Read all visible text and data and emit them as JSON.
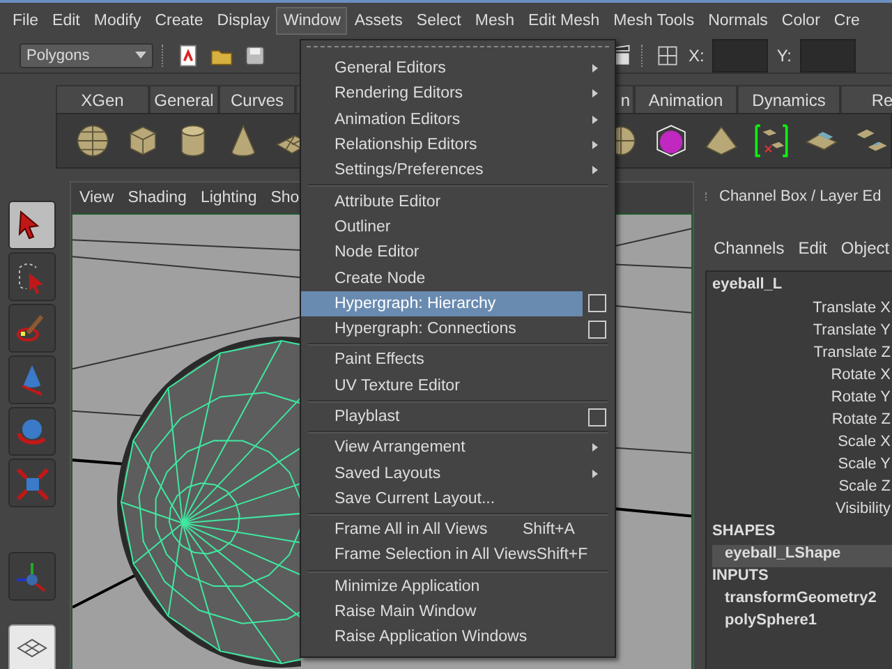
{
  "menu_bar": [
    {
      "label": "File",
      "selected": false
    },
    {
      "label": "Edit",
      "selected": false
    },
    {
      "label": "Modify",
      "selected": false
    },
    {
      "label": "Create",
      "selected": false
    },
    {
      "label": "Display",
      "selected": false
    },
    {
      "label": "Window",
      "selected": true
    },
    {
      "label": "Assets",
      "selected": false
    },
    {
      "label": "Select",
      "selected": false
    },
    {
      "label": "Mesh",
      "selected": false
    },
    {
      "label": "Edit Mesh",
      "selected": false
    },
    {
      "label": "Mesh Tools",
      "selected": false
    },
    {
      "label": "Normals",
      "selected": false
    },
    {
      "label": "Color",
      "selected": false
    },
    {
      "label": "Cre",
      "selected": false
    }
  ],
  "toolbar": {
    "mode_dropdown": "Polygons",
    "x_label": "X:",
    "y_label": "Y:"
  },
  "shelf": {
    "tabs": [
      {
        "label": "XGen",
        "selected": false
      },
      {
        "label": "General",
        "selected": false
      },
      {
        "label": "Curves",
        "selected": false
      },
      {
        "label": "n",
        "selected": false
      },
      {
        "label": "Animation",
        "selected": false
      },
      {
        "label": "Dynamics",
        "selected": false
      },
      {
        "label": "Re",
        "selected": false
      }
    ]
  },
  "toolbox": {
    "tools": [
      {
        "kind": "select",
        "selected": true
      },
      {
        "kind": "lasso",
        "selected": false
      },
      {
        "kind": "paint",
        "selected": false
      },
      {
        "kind": "move",
        "selected": false
      },
      {
        "kind": "rotate",
        "selected": false
      },
      {
        "kind": "scale",
        "selected": false
      },
      {
        "kind": "manipulator",
        "selected": false
      }
    ]
  },
  "viewport": {
    "menus": [
      "View",
      "Shading",
      "Lighting",
      "Sho"
    ]
  },
  "channel_box": {
    "title": "Channel Box / Layer Ed",
    "menus": [
      "Channels",
      "Edit",
      "Object"
    ],
    "object": "eyeball_L",
    "channels": [
      "Translate X",
      "Translate Y",
      "Translate Z",
      "Rotate X",
      "Rotate Y",
      "Rotate Z",
      "Scale X",
      "Scale Y",
      "Scale Z",
      "Visibility"
    ],
    "shapes_heading": "SHAPES",
    "shapes": [
      {
        "label": "eyeball_LShape",
        "selected": true
      }
    ],
    "inputs_heading": "INPUTS",
    "inputs": [
      "transformGeometry2",
      "polySphere1"
    ]
  },
  "window_menu": {
    "sections": [
      [
        {
          "label": "General Editors",
          "kind": "submenu",
          "selected": false
        },
        {
          "label": "Rendering Editors",
          "kind": "submenu",
          "selected": false
        },
        {
          "label": "Animation Editors",
          "kind": "submenu",
          "selected": false
        },
        {
          "label": "Relationship Editors",
          "kind": "submenu",
          "selected": false
        },
        {
          "label": "Settings/Preferences",
          "kind": "submenu",
          "selected": false
        }
      ],
      [
        {
          "label": "Attribute Editor",
          "kind": "plain",
          "selected": false
        },
        {
          "label": "Outliner",
          "kind": "plain",
          "selected": false
        },
        {
          "label": "Node Editor",
          "kind": "plain",
          "selected": false
        },
        {
          "label": "Create Node",
          "kind": "plain",
          "selected": false
        },
        {
          "label": "Hypergraph: Hierarchy",
          "kind": "option",
          "selected": true
        },
        {
          "label": "Hypergraph: Connections",
          "kind": "option",
          "selected": false
        }
      ],
      [
        {
          "label": "Paint Effects",
          "kind": "plain",
          "selected": false
        },
        {
          "label": "UV Texture Editor",
          "kind": "plain",
          "selected": false
        }
      ],
      [
        {
          "label": "Playblast",
          "kind": "option",
          "selected": false
        }
      ],
      [
        {
          "label": "View Arrangement",
          "kind": "submenu",
          "selected": false
        },
        {
          "label": "Saved Layouts",
          "kind": "submenu",
          "selected": false
        },
        {
          "label": "Save Current Layout...",
          "kind": "plain",
          "selected": false
        }
      ],
      [
        {
          "label": "Frame All in All Views",
          "kind": "plain",
          "shortcut": "Shift+A",
          "selected": false
        },
        {
          "label": "Frame Selection in All Views",
          "kind": "plain",
          "shortcut": "Shift+F",
          "selected": false
        }
      ],
      [
        {
          "label": "Minimize Application",
          "kind": "plain",
          "selected": false
        },
        {
          "label": "Raise Main Window",
          "kind": "plain",
          "selected": false
        },
        {
          "label": "Raise Application Windows",
          "kind": "plain",
          "selected": false
        }
      ]
    ]
  }
}
